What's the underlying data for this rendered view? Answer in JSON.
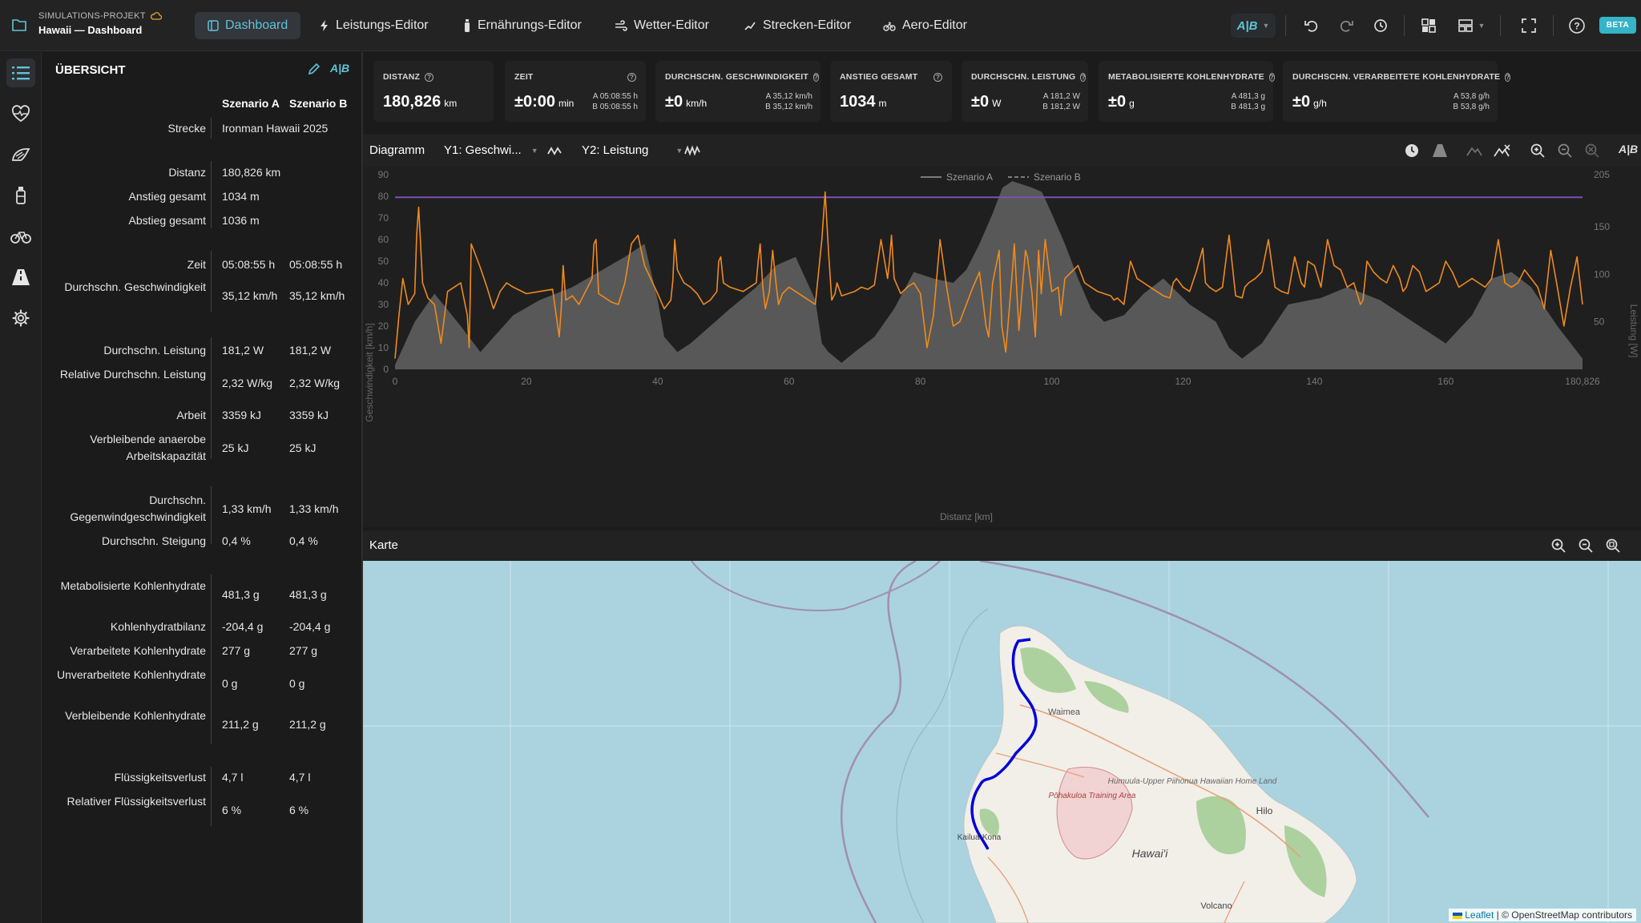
{
  "project": {
    "kicker": "SIMULATIONS-PROJEKT",
    "title": "Hawaii — Dashboard"
  },
  "nav_tabs": [
    {
      "label": "Dashboard",
      "icon": "dashboard-icon"
    },
    {
      "label": "Leistungs-Editor",
      "icon": "bolt-icon"
    },
    {
      "label": "Ernährungs-Editor",
      "icon": "bottle-icon"
    },
    {
      "label": "Wetter-Editor",
      "icon": "wind-icon"
    },
    {
      "label": "Strecken-Editor",
      "icon": "route-icon"
    },
    {
      "label": "Aero-Editor",
      "icon": "cyclist-icon"
    }
  ],
  "toolbar": {
    "ab_label": "A|B",
    "beta_label": "BETA"
  },
  "overview": {
    "title": "ÜBERSICHT",
    "col_a": "Szenario A",
    "col_b": "Szenario B",
    "rows": [
      {
        "label": "Strecke",
        "a": "Ironman Hawaii 2025",
        "b": ""
      },
      {
        "label": "Distanz",
        "a": "180,826 km",
        "b": ""
      },
      {
        "label": "Anstieg gesamt",
        "a": "1034 m",
        "b": ""
      },
      {
        "label": "Abstieg gesamt",
        "a": "1036 m",
        "b": ""
      },
      {
        "label": "Zeit",
        "a": "05:08:55 h",
        "b": "05:08:55 h"
      },
      {
        "label": "Durchschn. Geschwindigkeit",
        "a": "35,12 km/h",
        "b": "35,12 km/h"
      },
      {
        "label": "Durchschn. Leistung",
        "a": "181,2 W",
        "b": "181,2 W"
      },
      {
        "label": "Relative Durchschn. Leistung",
        "a": "2,32 W/kg",
        "b": "2,32 W/kg"
      },
      {
        "label": "Arbeit",
        "a": "3359 kJ",
        "b": "3359 kJ"
      },
      {
        "label": "Verbleibende anaerobe Arbeitskapazität",
        "a": "25 kJ",
        "b": "25 kJ"
      },
      {
        "label": "Durchschn. Gegenwindgeschwindigkeit",
        "a": "1,33 km/h",
        "b": "1,33 km/h"
      },
      {
        "label": "Durchschn. Steigung",
        "a": "0,4 %",
        "b": "0,4 %"
      },
      {
        "label": "Metabolisierte Kohlenhydrate",
        "a": "481,3 g",
        "b": "481,3 g"
      },
      {
        "label": "Kohlenhydratbilanz",
        "a": "-204,4 g",
        "b": "-204,4 g"
      },
      {
        "label": "Verarbeitete Kohlenhydrate",
        "a": "277 g",
        "b": "277 g"
      },
      {
        "label": "Unverarbeitete Kohlenhydrate",
        "a": "0 g",
        "b": "0 g"
      },
      {
        "label": "Verbleibende Kohlenhydrate",
        "a": "211,2 g",
        "b": "211,2 g"
      },
      {
        "label": "Flüssigkeitsverlust",
        "a": "4,7 l",
        "b": "4,7 l"
      },
      {
        "label": "Relativer Flüssigkeitsverlust",
        "a": "6 %",
        "b": "6 %"
      }
    ]
  },
  "metrics": [
    {
      "label": "DISTANZ",
      "value": "180,826",
      "unit": "km",
      "a": "",
      "b": ""
    },
    {
      "label": "ZEIT",
      "value": "±0:00",
      "unit": "min",
      "a": "A 05:08:55 h",
      "b": "B 05:08:55 h"
    },
    {
      "label": "DURCHSCHN. GESCHWINDIGKEIT",
      "value": "±0",
      "unit": "km/h",
      "a": "A 35,12 km/h",
      "b": "B 35,12 km/h"
    },
    {
      "label": "ANSTIEG GESAMT",
      "value": "1034",
      "unit": "m",
      "a": "",
      "b": ""
    },
    {
      "label": "DURCHSCHN. LEISTUNG",
      "value": "±0",
      "unit": "W",
      "a": "A 181,2 W",
      "b": "B 181,2 W"
    },
    {
      "label": "METABOLISIERTE KOHLENHYDRATE",
      "value": "±0",
      "unit": "g",
      "a": "A 481,3 g",
      "b": "B 481,3 g"
    },
    {
      "label": "DURCHSCHN. VERARBEITETE KOHLENHYDRATE",
      "value": "±0",
      "unit": "g/h",
      "a": "A 53,8 g/h",
      "b": "B 53,8 g/h"
    }
  ],
  "chart_toolbar": {
    "title": "Diagramm",
    "y1": "Y1: Geschwi...",
    "y2": "Y2: Leistung"
  },
  "chart_data": {
    "type": "line",
    "xlabel": "Distanz [km]",
    "ylabel": "Geschwindigkeit [km/h]",
    "y2label": "Leistung [W]",
    "xlim": [
      0,
      180.826
    ],
    "ylim": [
      0,
      90
    ],
    "y2lim": [
      0,
      205
    ],
    "xticks": [
      "0",
      "20",
      "40",
      "60",
      "80",
      "100",
      "120",
      "140",
      "160",
      "180,826"
    ],
    "yticks": [
      "0",
      "10",
      "20",
      "30",
      "40",
      "50",
      "60",
      "70",
      "80",
      "90"
    ],
    "y2ticks": [
      "50",
      "100",
      "150",
      "205"
    ],
    "legend": [
      "Szenario A",
      "Szenario B"
    ],
    "legend_position": "top-center",
    "colors": {
      "speed": "#f08a1c",
      "power": "#7d4fb8",
      "elevation": "#585858"
    },
    "power_line_value": 181.2,
    "elevation": {
      "x": [
        0,
        3,
        6,
        10,
        13,
        18,
        22,
        27,
        31,
        35,
        38,
        40,
        41,
        43,
        45,
        48,
        51,
        55,
        58,
        61,
        64,
        65,
        66,
        68,
        70,
        73,
        76,
        79,
        82,
        85,
        87,
        89,
        91,
        92.5,
        94,
        95,
        96,
        97,
        98.5,
        100,
        102,
        104,
        106,
        108,
        111,
        114,
        117,
        121,
        125,
        127,
        129,
        132,
        136,
        141,
        145,
        150,
        155,
        160,
        164,
        167,
        170,
        173,
        177,
        180.826
      ],
      "y": [
        2,
        22,
        35,
        20,
        8,
        25,
        32,
        38,
        45,
        52,
        58,
        32,
        15,
        8,
        12,
        20,
        28,
        38,
        48,
        52,
        32,
        12,
        8,
        3,
        8,
        15,
        28,
        45,
        42,
        40,
        46,
        58,
        72,
        84,
        87,
        86,
        85,
        84,
        82,
        72,
        58,
        42,
        28,
        22,
        25,
        35,
        42,
        30,
        22,
        10,
        5,
        12,
        30,
        33,
        38,
        32,
        22,
        12,
        25,
        42,
        45,
        38,
        20,
        5
      ]
    },
    "speed": {
      "x": [
        0,
        0.6,
        1.2,
        2,
        3,
        3.3,
        3.6,
        4.2,
        5,
        6,
        7,
        8,
        9,
        10,
        11,
        11.3,
        11.6,
        12,
        13,
        14,
        15,
        16,
        17,
        18,
        20,
        22,
        24,
        25,
        25.3,
        25.6,
        26,
        27,
        28,
        29,
        30,
        30.3,
        30.6,
        31,
        32,
        33,
        34,
        35,
        36,
        37,
        38,
        40,
        41,
        42,
        42.3,
        42.6,
        43,
        44,
        45,
        46,
        47,
        48,
        49,
        49.3,
        49.6,
        50,
        51,
        52,
        53,
        54,
        55,
        55.3,
        55.6,
        56,
        56.4,
        57,
        57.5,
        58,
        58.4,
        59,
        60,
        61,
        62,
        63,
        64,
        65,
        65.5,
        66,
        66.5,
        67,
        67.3,
        68,
        69,
        70,
        71,
        72,
        73,
        74,
        75,
        75.3,
        75.6,
        76,
        77,
        78,
        79,
        80,
        81,
        82,
        83,
        84,
        85,
        86,
        87,
        88,
        89,
        90,
        90.4,
        91,
        92,
        92.4,
        93,
        94,
        94.3,
        95,
        96,
        96.3,
        97,
        97.5,
        98,
        98.4,
        99,
        100,
        101,
        101.4,
        102,
        103,
        104,
        105,
        106,
        107,
        108,
        109,
        109.5,
        110,
        111,
        112,
        113,
        114,
        115,
        116,
        117,
        118,
        118.5,
        119,
        120,
        121,
        122,
        123,
        123.4,
        124,
        125,
        126,
        127,
        128,
        129,
        129.4,
        130,
        131,
        132,
        133,
        134,
        135,
        136,
        137,
        138,
        138.5,
        139,
        140,
        141,
        142,
        143,
        144,
        145,
        146,
        147,
        147.4,
        148,
        149,
        150,
        151,
        152,
        153,
        153.5,
        154,
        155,
        156,
        157,
        158,
        159,
        160,
        161,
        162,
        163,
        164,
        165,
        166,
        167,
        168,
        169,
        170,
        171,
        172,
        173,
        174,
        175,
        176,
        177,
        178,
        179,
        180,
        180.826
      ],
      "y": [
        5,
        25,
        42,
        30,
        35,
        62,
        75,
        40,
        33,
        30,
        12,
        36,
        38,
        40,
        25,
        10,
        58,
        55,
        47,
        38,
        28,
        36,
        40,
        38,
        35,
        36,
        37,
        15,
        28,
        48,
        32,
        34,
        30,
        36,
        42,
        58,
        60,
        35,
        33,
        31,
        30,
        40,
        58,
        62,
        48,
        35,
        28,
        32,
        41,
        60,
        46,
        40,
        38,
        35,
        30,
        32,
        36,
        50,
        52,
        40,
        38,
        37,
        36,
        38,
        40,
        50,
        58,
        38,
        28,
        36,
        55,
        40,
        30,
        35,
        38,
        36,
        34,
        32,
        30,
        60,
        82,
        55,
        32,
        35,
        40,
        34,
        35,
        36,
        38,
        37,
        39,
        60,
        42,
        50,
        62,
        42,
        35,
        38,
        40,
        35,
        10,
        25,
        60,
        38,
        20,
        22,
        30,
        38,
        45,
        20,
        15,
        40,
        55,
        20,
        8,
        45,
        58,
        18,
        55,
        52,
        35,
        15,
        55,
        35,
        60,
        36,
        38,
        25,
        42,
        45,
        48,
        40,
        38,
        36,
        35,
        34,
        32,
        33,
        30,
        50,
        42,
        40,
        38,
        36,
        34,
        33,
        40,
        42,
        38,
        36,
        45,
        56,
        40,
        38,
        36,
        38,
        62,
        34,
        33,
        38,
        40,
        42,
        45,
        60,
        38,
        36,
        35,
        52,
        40,
        38,
        50,
        48,
        38,
        60,
        48,
        46,
        38,
        40,
        30,
        32,
        50,
        45,
        42,
        40,
        48,
        42,
        36,
        38,
        48,
        45,
        36,
        38,
        40,
        50,
        45,
        38,
        40,
        42,
        40,
        38,
        42,
        60,
        40,
        38,
        40,
        46,
        42,
        38,
        28,
        55,
        38,
        20,
        38,
        52,
        30
      ]
    }
  },
  "map": {
    "title": "Karte",
    "place_labels": [
      "Waimea",
      "Pōhakuloa Training Area",
      "Humuula-Upper Piihonua Hawaiian Home Land",
      "Hilo",
      "Kailua-Kona",
      "Hawai'i",
      "Volcano"
    ],
    "attribution_link": "Leaflet",
    "attribution_text": "| © OpenStreetMap contributors",
    "route_color": "#0000dd"
  }
}
